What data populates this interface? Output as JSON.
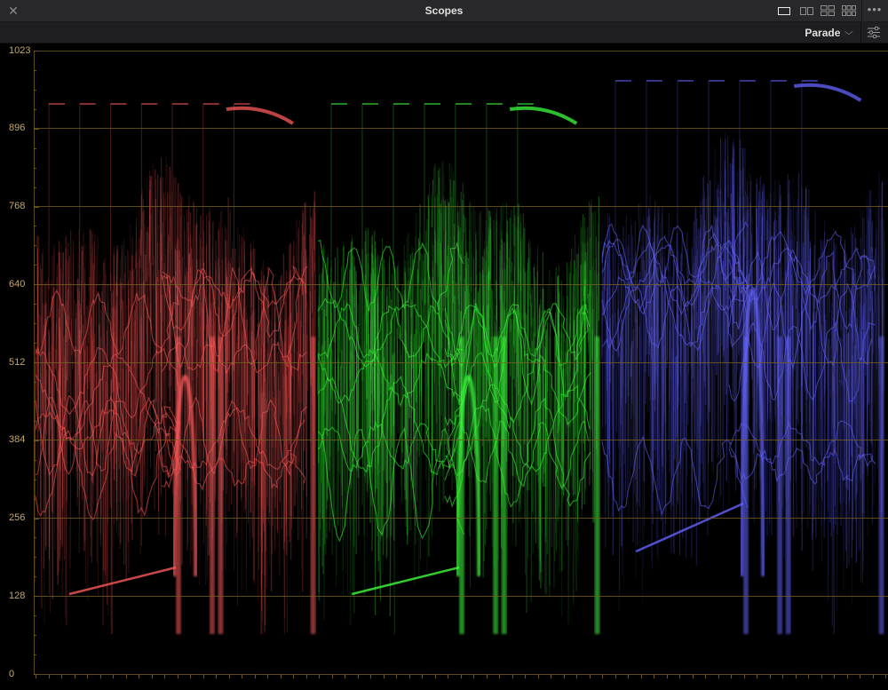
{
  "window": {
    "title": "Scopes",
    "close_icon": "close-icon",
    "more_icon": "more-icon",
    "layouts": [
      {
        "name": "single-layout-icon",
        "panes": 1,
        "active": true
      },
      {
        "name": "dual-layout-icon",
        "panes": 2,
        "active": false
      },
      {
        "name": "quad-layout-icon",
        "panes": 4,
        "active": false
      },
      {
        "name": "grid-layout-icon",
        "panes": 6,
        "active": false
      }
    ]
  },
  "toolbar": {
    "mode": "Parade",
    "mode_dropdown_icon": "chevron-down-icon",
    "settings_icon": "sliders-icon"
  },
  "scope": {
    "type": "RGB parade",
    "y_axis_labels": [
      "1023",
      "896",
      "768",
      "640",
      "512",
      "384",
      "256",
      "128",
      "0"
    ],
    "y_range": [
      0,
      1023
    ],
    "grid_color": "#7a6420",
    "label_color": "#c8a866",
    "channels": [
      {
        "name": "red",
        "color": "#ff5a5a"
      },
      {
        "name": "green",
        "color": "#3cff3c"
      },
      {
        "name": "blue",
        "color": "#6464ff"
      }
    ]
  }
}
